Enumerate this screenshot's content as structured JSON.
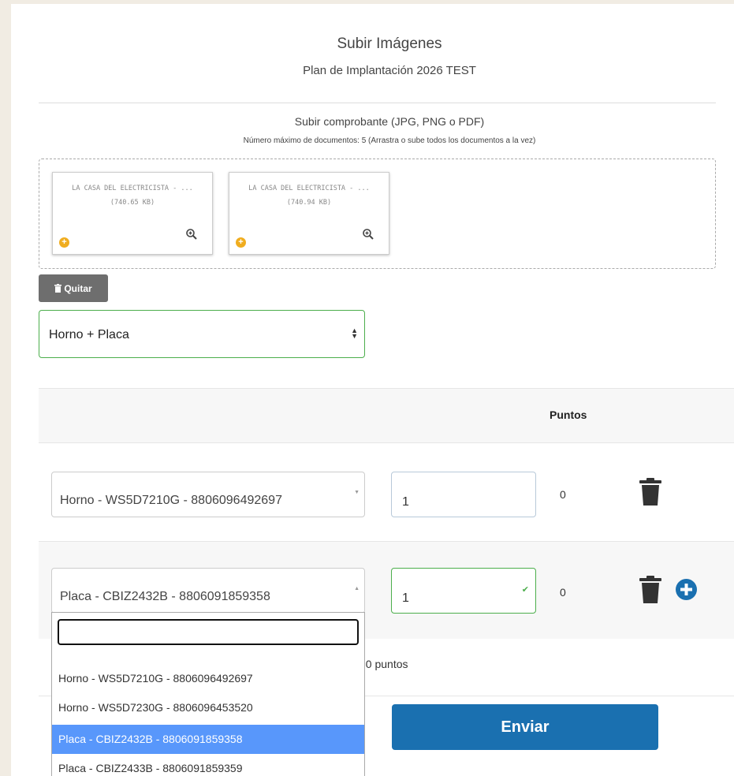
{
  "header": {
    "title": "Subir Imágenes",
    "subtitle": "Plan de Implantación 2026 TEST"
  },
  "upload": {
    "label": "Subir comprobante (JPG, PNG o PDF)",
    "hint": "Número máximo de documentos: 5 (Arrastra o sube todos los documentos a la vez)",
    "files": [
      {
        "name": "LA CASA DEL ELECTRICISTA - ...",
        "size": "(740.65 KB)"
      },
      {
        "name": "LA CASA DEL ELECTRICISTA - ...",
        "size": "(740.94 KB)"
      }
    ],
    "remove_label": "Quitar"
  },
  "category": {
    "value": "Horno + Placa"
  },
  "table": {
    "points_header": "Puntos",
    "rows": [
      {
        "product": "Horno - WS5D7210G - 8806096492697",
        "quantity": "1",
        "points": "0"
      },
      {
        "product": "Placa - CBIZ2432B - 8806091859358",
        "quantity": "1",
        "points": "0"
      }
    ]
  },
  "dropdown": {
    "search_value": "",
    "options": [
      {
        "label": "Horno - WS5D7210G - 8806096492697",
        "selected": false
      },
      {
        "label": "Horno - WS5D7230G - 8806096453520",
        "selected": false
      },
      {
        "label": "Placa - CBIZ2432B - 8806091859358",
        "selected": true
      },
      {
        "label": "Placa - CBIZ2433B - 8806091859359",
        "selected": false
      }
    ]
  },
  "total": {
    "text": ": 0 puntos"
  },
  "submit": {
    "label": "Enviar"
  },
  "colors": {
    "primary": "#1a70b0",
    "valid_border": "#4cae4c",
    "selected_option": "#5897fb",
    "file_badge": "#f0ad1f",
    "remove_button": "#6e6e6e"
  }
}
